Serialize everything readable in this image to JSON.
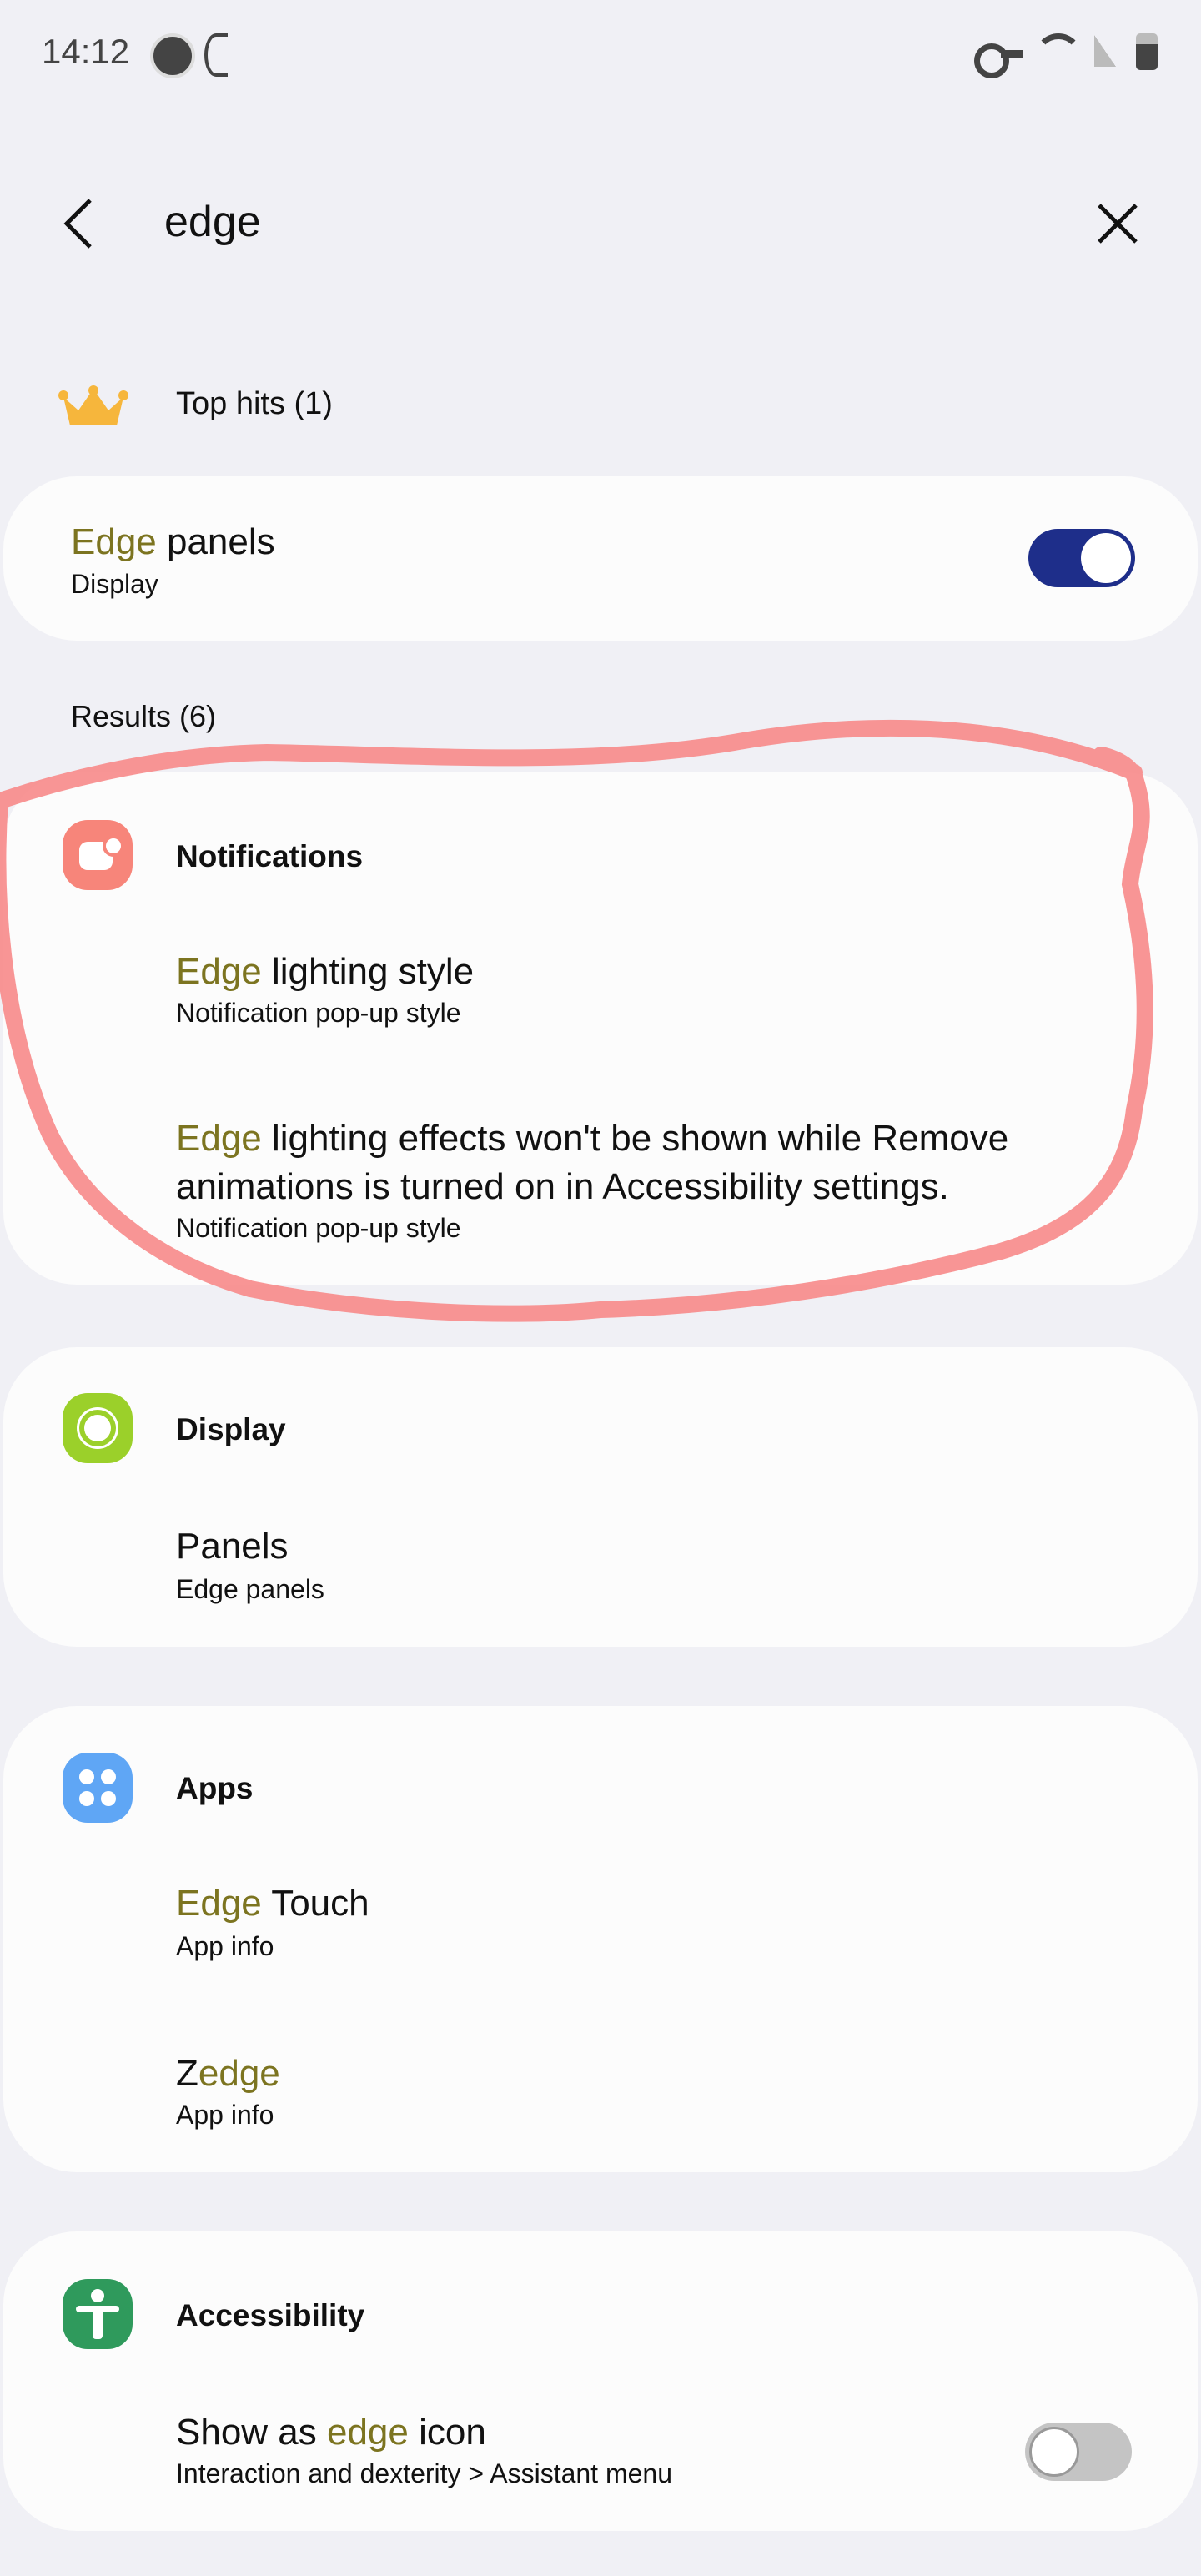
{
  "status_bar": {
    "time": "14:12",
    "left_icons": [
      "nordvpn-icon",
      "eye-comfort-icon"
    ],
    "right_icons": [
      "vpn-key-icon",
      "wifi-icon",
      "signal-icon",
      "battery-icon"
    ]
  },
  "search": {
    "query": "edge",
    "back_icon": "chevron-left-icon",
    "clear_icon": "close-icon"
  },
  "top_hits": {
    "label": "Top hits (1)",
    "icon": "crown-icon",
    "items": [
      {
        "highlight": "Edge",
        "rest": " panels",
        "subtitle": "Display",
        "toggle_on": true
      }
    ]
  },
  "results": {
    "label": "Results (6)",
    "groups": [
      {
        "category": "Notifications",
        "icon": "notifications-icon",
        "color": "#f7857a",
        "items": [
          {
            "highlight": "Edge",
            "rest": " lighting style",
            "subtitle": "Notification pop-up style"
          },
          {
            "highlight": "Edge",
            "rest": " lighting effects won't be shown while Remove animations is turned on in Accessibility settings.",
            "subtitle": "Notification pop-up style"
          }
        ]
      },
      {
        "category": "Display",
        "icon": "sun-icon",
        "color": "#9bd02a",
        "items": [
          {
            "prefix": "Panels",
            "subtitle": "Edge panels"
          }
        ]
      },
      {
        "category": "Apps",
        "icon": "apps-grid-icon",
        "color": "#5fa6f5",
        "items": [
          {
            "highlight": "Edge",
            "rest": " Touch",
            "subtitle": "App info"
          },
          {
            "prefix": "Z",
            "highlight": "edge",
            "subtitle": "App info"
          }
        ]
      },
      {
        "category": "Accessibility",
        "icon": "accessibility-icon",
        "color": "#2f9a5c",
        "items": [
          {
            "prefix": "Show as ",
            "highlight": "edge",
            "rest": " icon",
            "subtitle": "Interaction and dexterity > Assistant menu",
            "toggle_on": false
          }
        ]
      }
    ]
  },
  "colors": {
    "highlight": "#7c7420",
    "toggle_on": "#1e2e8a",
    "toggle_off": "#c4c4c4",
    "annotation": "#f78a8a",
    "background": "#f0f0f5"
  }
}
